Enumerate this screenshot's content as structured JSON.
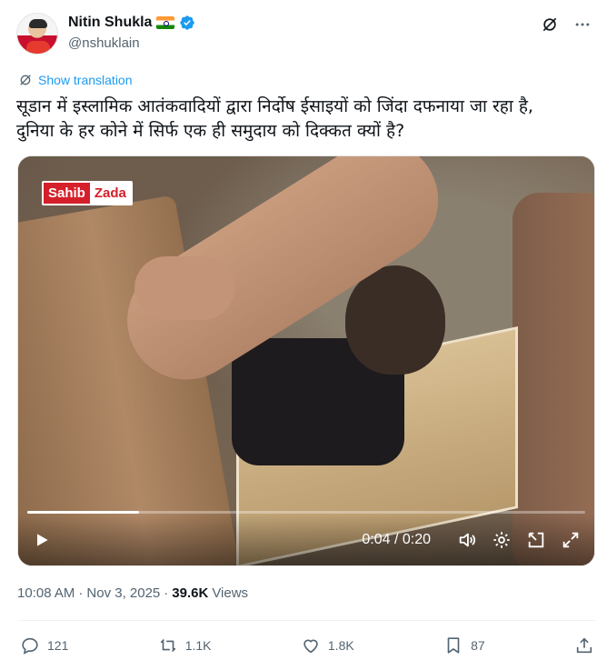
{
  "author": {
    "display_name": "Nitin Shukla",
    "handle": "@nshuklain",
    "verified": true,
    "flag": "india-flag"
  },
  "translate_label": "Show translation",
  "tweet_text_lines": [
    "सूडान में इस्लामिक आतंकवादियों द्वारा निर्दोष ईसाइयों को जिंदा दफनाया जा रहा है,",
    "दुनिया के हर कोने में सिर्फ एक ही समुदाय को दिक्कत क्यों है?"
  ],
  "video": {
    "watermark_part1": "Sahib",
    "watermark_part2": "Zada",
    "timecode": "0:04 / 0:20",
    "progress": 0.2
  },
  "meta": {
    "time": "10:08 AM",
    "separator": "·",
    "date": "Nov 3, 2025",
    "views_count": "39.6K",
    "views_label": "Views"
  },
  "actions": {
    "replies": "121",
    "reposts": "1.1K",
    "likes": "1.8K",
    "bookmarks": "87"
  },
  "colors": {
    "accent": "#1d9bf0",
    "text": "#0f1419",
    "muted": "#536471",
    "watermark_red": "#d51f2a"
  }
}
